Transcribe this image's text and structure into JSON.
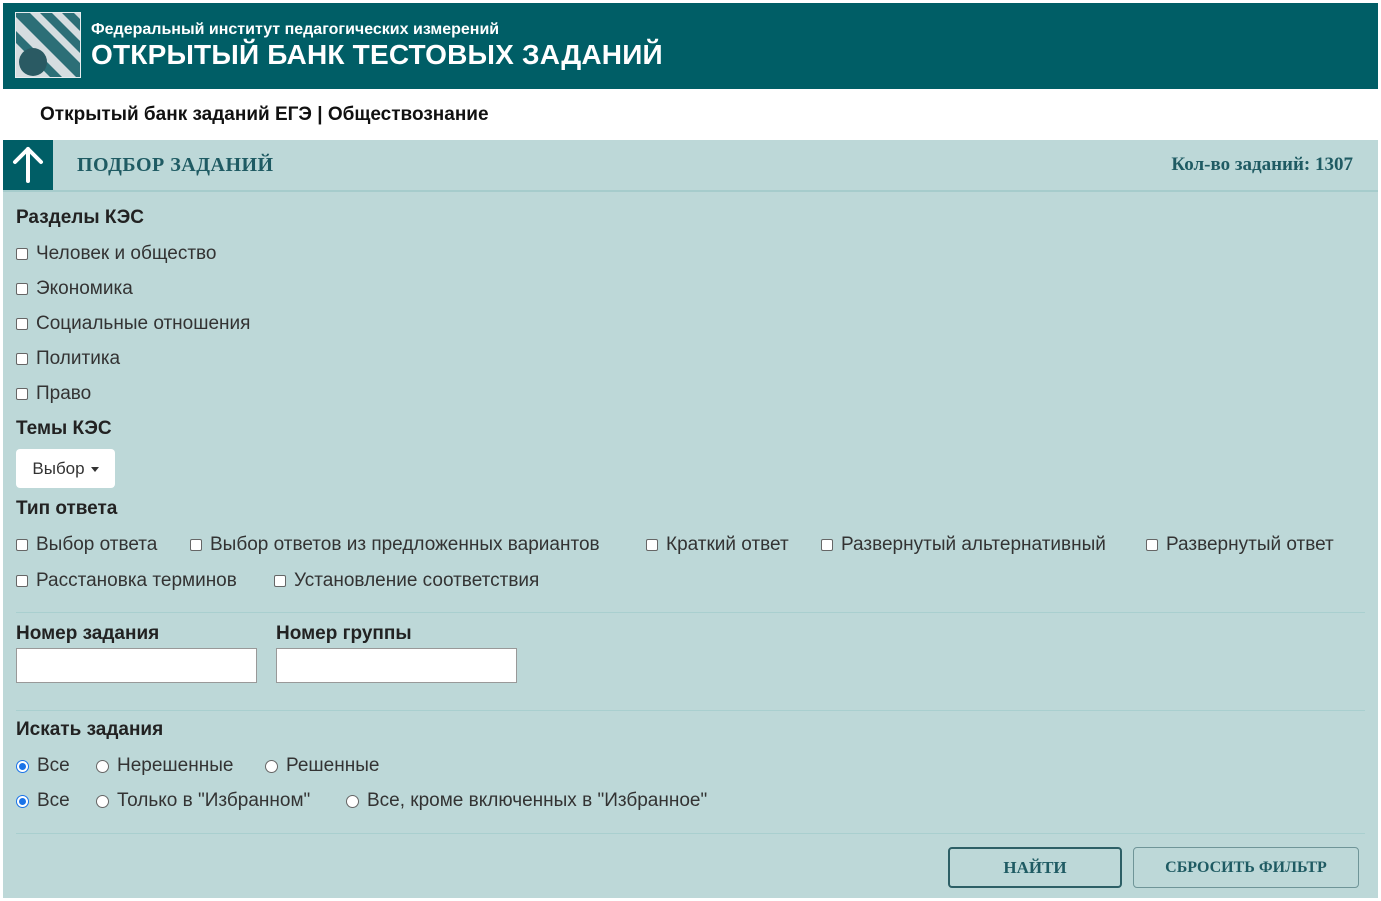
{
  "header": {
    "subtitle": "Федеральный институт педагогических измерений",
    "title": "ОТКРЫТЫЙ БАНК ТЕСТОВЫХ ЗАДАНИЙ",
    "color": "#005e66"
  },
  "subbar": {
    "text": "Открытый банк заданий ЕГЭ | Обществознание"
  },
  "panel": {
    "title": "ПОДБОР ЗАДАНИЙ",
    "count": "Кол-во заданий: 1307",
    "background": "#bdd8d8"
  },
  "sections": {
    "label": "Разделы КЭС",
    "items": [
      "Человек и общество",
      "Экономика",
      "Социальные отношения",
      "Политика",
      "Право"
    ]
  },
  "topics": {
    "label": "Темы КЭС",
    "dropdown_label": "Выбор"
  },
  "answer_type": {
    "label": "Тип ответа",
    "items": [
      "Выбор ответа",
      "Выбор ответов из предложенных вариантов",
      "Краткий ответ",
      "Развернутый альтернативный",
      "Развернутый ответ",
      "Расстановка терминов",
      "Установление соответствия"
    ]
  },
  "fields": {
    "task_number_label": "Номер задания",
    "task_number_value": "",
    "group_number_label": "Номер группы",
    "group_number_value": ""
  },
  "search": {
    "label": "Искать задания",
    "row1": [
      "Все",
      "Нерешенные",
      "Решенные"
    ],
    "row1_selected": "Все",
    "row2": [
      "Все",
      "Только в \"Избранном\"",
      "Все, кроме включенных в \"Избранное\""
    ],
    "row2_selected": "Все"
  },
  "buttons": {
    "find": "НАЙТИ",
    "reset": "СБРОСИТЬ ФИЛЬТР"
  },
  "icons": {
    "logo": "fipi-logo",
    "up": "arrow-up-icon"
  }
}
